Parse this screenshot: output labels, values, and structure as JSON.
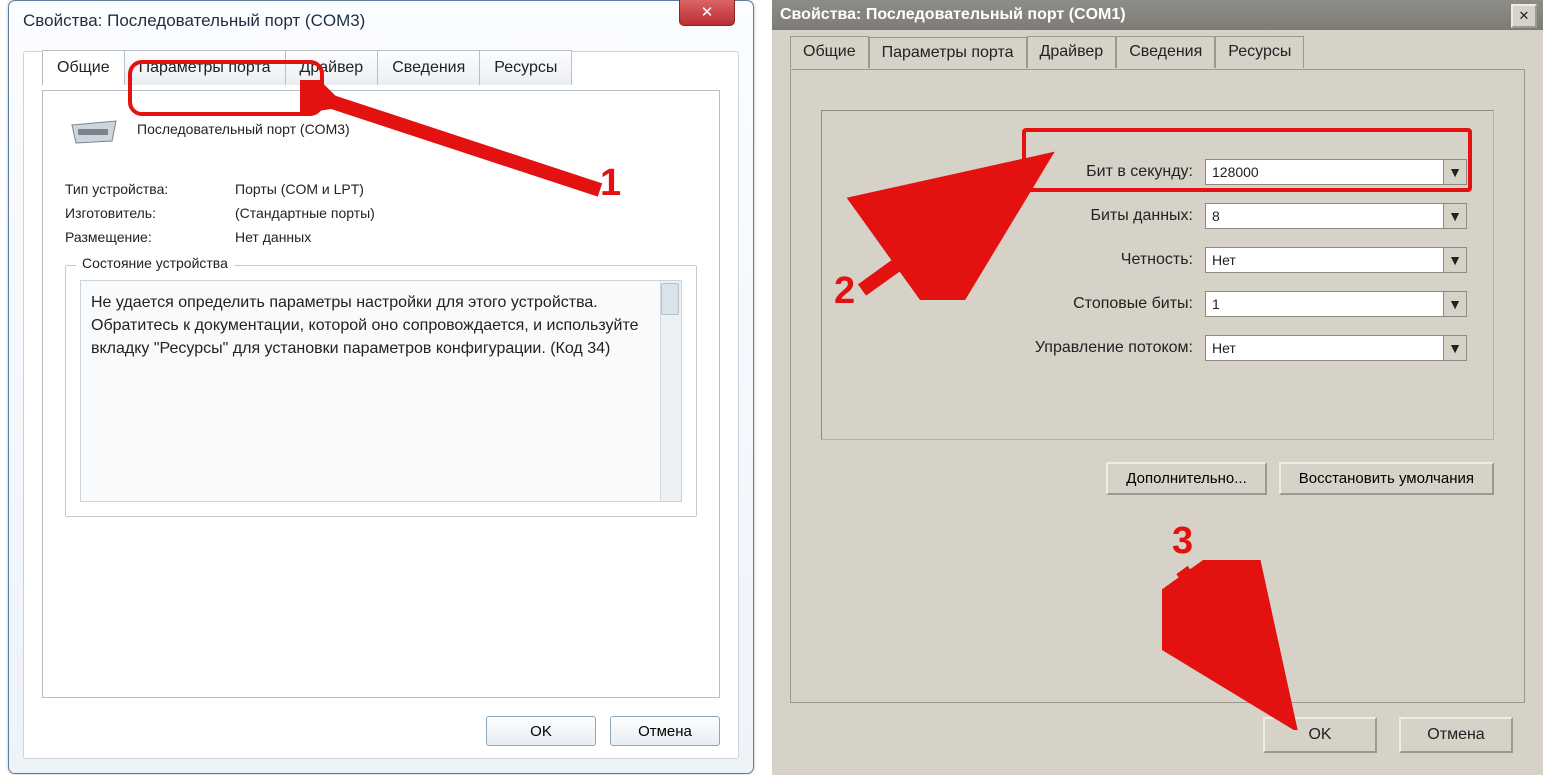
{
  "left": {
    "title": "Свойства: Последовательный порт (COM3)",
    "tabs": [
      "Общие",
      "Параметры порта",
      "Драйвер",
      "Сведения",
      "Ресурсы"
    ],
    "active_tab": 0,
    "device_name": "Последовательный порт (COM3)",
    "rows": {
      "type_lbl": "Тип устройства:",
      "type_val": "Порты (COM и LPT)",
      "mfr_lbl": "Изготовитель:",
      "mfr_val": "(Стандартные порты)",
      "loc_lbl": "Размещение:",
      "loc_val": "Нет данных"
    },
    "group_title": "Состояние устройства",
    "status_text": "Не удается определить параметры настройки для этого устройства. Обратитесь к документации, которой оно сопровождается, и используйте вкладку \"Ресурсы\" для установки параметров конфигурации. (Код 34)",
    "ok": "OK",
    "cancel": "Отмена"
  },
  "right": {
    "title": "Свойства: Последовательный порт (COM1)",
    "tabs": [
      "Общие",
      "Параметры порта",
      "Драйвер",
      "Сведения",
      "Ресурсы"
    ],
    "active_tab": 1,
    "fields": {
      "bps_lbl": "Бит в секунду:",
      "bps_val": "128000",
      "bits_lbl": "Биты данных:",
      "bits_val": "8",
      "parity_lbl": "Четность:",
      "parity_val": "Нет",
      "stop_lbl": "Стоповые биты:",
      "stop_val": "1",
      "flow_lbl": "Управление потоком:",
      "flow_val": "Нет"
    },
    "advanced": "Дополнительно...",
    "restore": "Восстановить умолчания",
    "ok": "OK",
    "cancel": "Отмена"
  },
  "annotations": {
    "n1": "1",
    "n2": "2",
    "n3": "3"
  }
}
